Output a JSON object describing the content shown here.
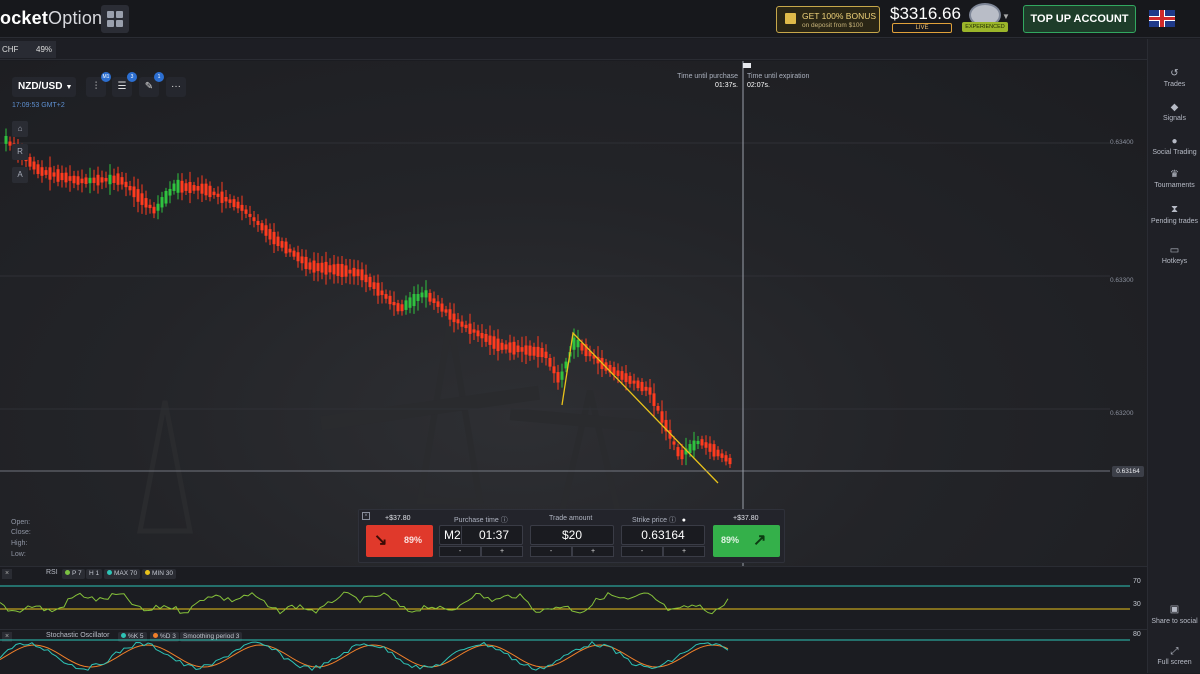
{
  "header": {
    "logo_bold": "ocket",
    "logo_light": "Option",
    "bonus_line1": "GET 100% BONUS",
    "bonus_line2": "on deposit from $100",
    "balance": "$3316.66",
    "account_type": "LIVE",
    "level": "EXPERIENCED",
    "top_up": "TOP UP ACCOUNT",
    "language_flag": "uk-flag-icon"
  },
  "asset_tab": {
    "name": "CHF",
    "percent": "49%"
  },
  "chart": {
    "pair": "NZD/USD",
    "time": "17:09:53 GMT+2",
    "tool_badges": [
      "M1",
      "3",
      "1"
    ],
    "side_buttons": [
      "R",
      "A"
    ],
    "ohlc_labels": [
      "Open:",
      "Close:",
      "High:",
      "Low:"
    ],
    "timer_purchase_label": "Time until purchase",
    "timer_purchase_value": "01:37s.",
    "timer_expiration_label": "Time until expiration",
    "timer_expiration_value": "02:07s.",
    "price_levels": [
      "0.63400",
      "0.63300",
      "0.63200"
    ],
    "current_price": "0.63164",
    "colors": {
      "up": "#2fc23f",
      "down": "#ff3b1f",
      "trendline": "#e8c21b"
    }
  },
  "trade_panel": {
    "sell_profit": "+$37.80",
    "sell_percent": "89%",
    "buy_profit": "+$37.80",
    "buy_percent": "89%",
    "purchase_time_label": "Purchase time",
    "purchase_time_mode": "M2",
    "purchase_time_value": "01:37",
    "trade_amount_label": "Trade amount",
    "trade_amount_value": "$20",
    "strike_price_label": "Strike price",
    "strike_price_value": "0.63164",
    "minus": "-",
    "plus": "+"
  },
  "rsi": {
    "name": "RSI",
    "chips": [
      "P 7",
      "H 1",
      "MAX 70",
      "MIN 30"
    ],
    "levels": [
      "70",
      "30"
    ]
  },
  "stochastic": {
    "name": "Stochastic Oscillator",
    "chips": [
      "%K 5",
      "%D 3",
      "Smoothing period 3"
    ],
    "levels": [
      "80"
    ]
  },
  "right_sidebar": {
    "items": [
      "Trades",
      "Signals",
      "Social Trading",
      "Tournaments",
      "Pending trades",
      "Hotkeys"
    ],
    "bottom_items": [
      "Share to social",
      "Full screen"
    ]
  }
}
